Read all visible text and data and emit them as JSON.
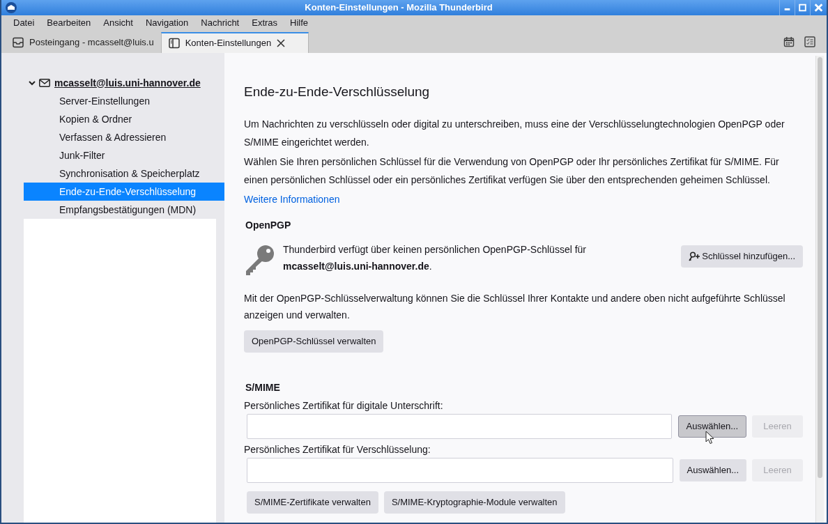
{
  "window": {
    "title": "Konten-Einstellungen - Mozilla Thunderbird"
  },
  "menu": [
    "Datei",
    "Bearbeiten",
    "Ansicht",
    "Navigation",
    "Nachricht",
    "Extras",
    "Hilfe"
  ],
  "tabs": [
    {
      "label": "Posteingang - mcasselt@luis.u",
      "kind": "inbox",
      "selected": false,
      "closable": false
    },
    {
      "label": "Konten-Einstellungen",
      "kind": "settings",
      "selected": true,
      "closable": true
    }
  ],
  "sidebar": {
    "account": {
      "label": "mcasselt@luis.uni-hannover.de",
      "expanded": true
    },
    "items": [
      {
        "label": "Server-Einstellungen",
        "selected": false
      },
      {
        "label": "Kopien & Ordner",
        "selected": false
      },
      {
        "label": "Verfassen & Adressieren",
        "selected": false
      },
      {
        "label": "Junk-Filter",
        "selected": false
      },
      {
        "label": "Synchronisation & Speicherplatz",
        "selected": false
      },
      {
        "label": "Ende-zu-Ende-Verschlüsselung",
        "selected": true
      },
      {
        "label": "Empfangsbestätigungen (MDN)",
        "selected": false
      }
    ]
  },
  "main": {
    "title": "Ende-zu-Ende-Verschlüsselung",
    "intro": [
      "Um Nachrichten zu verschlüsseln oder digital zu unterschreiben, muss eine der Verschlüsselungtechnologien OpenPGP oder S/MIME eingerichtet werden.",
      "Wählen Sie Ihren persönlichen Schlüssel für die Verwendung von OpenPGP oder Ihr persönliches Zertifikat für S/MIME. Für einen persönlichen Schlüssel oder ein persönliches Zertifikat verfügen Sie über den entsprechenden geheimen Schlüssel."
    ],
    "link": "Weitere Informationen",
    "openpgp": {
      "heading": "OpenPGP",
      "message": "Thunderbird verfügt über keinen persönlichen OpenPGP-Schlüssel für **mcasselt@luis.uni-hannover.de**.",
      "add_button": "Schlüssel hinzufügen...",
      "manage_text": "Mit der OpenPGP-Schlüsselverwaltung können Sie die Schlüssel Ihrer Kontakte und andere oben nicht aufgeführte Schlüssel anzeigen und verwalten.",
      "manage_button": "OpenPGP-Schlüssel verwalten"
    },
    "smime": {
      "heading": "S/MIME",
      "certs": [
        {
          "label": "Persönliches Zertifikat für digitale Unterschrift:",
          "select": {
            "label": "Auswählen...",
            "hovered": true
          },
          "clear": {
            "label": "Leeren",
            "disabled": true
          }
        },
        {
          "label": "Persönliches Zertifikat für Verschlüsselung:",
          "select": {
            "label": "Auswählen...",
            "hovered": false
          },
          "clear": {
            "label": "Leeren",
            "disabled": true
          }
        }
      ],
      "buttons": [
        "S/MIME-Zertifikate verwalten",
        "S/MIME-Kryptographie-Module verwalten"
      ]
    }
  }
}
